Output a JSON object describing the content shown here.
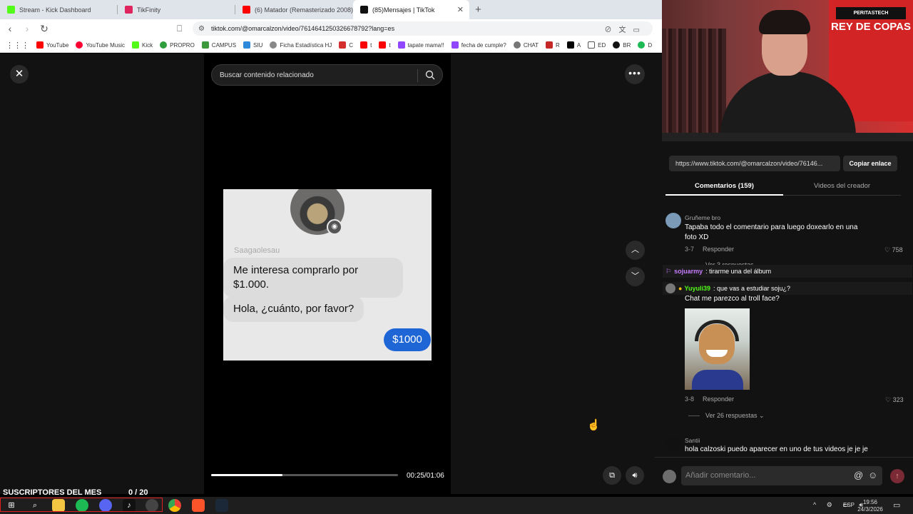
{
  "browser": {
    "tabs": [
      {
        "title": "Stream - Kick Dashboard",
        "color": "#53fc18"
      },
      {
        "title": "TikFinity",
        "color": "#e0245e"
      },
      {
        "title": "(6) Matador (Remasterizado 2008) -",
        "color": "#ff0000"
      },
      {
        "title": "(85)Mensajes | TikTok",
        "color": "#111111"
      }
    ],
    "url": "tiktok.com/@omarcalzon/video/7614641250326678792?lang=es",
    "bookmarks": [
      "YouTube",
      "YouTube Music",
      "Kick",
      "PROPRO",
      "CAMPUS",
      "SIU",
      "Ficha Estadística HJ",
      "C",
      "t",
      "t",
      "tapate mama!!",
      "fecha de cumple?",
      "CHAT",
      "R",
      "A",
      "ED",
      "BR",
      "D"
    ]
  },
  "tiktok": {
    "search_placeholder": "Buscar contenido relacionado",
    "video": {
      "username": "Saagaolesau",
      "message1": "Me interesa comprarlo por $1.000.",
      "message2": "Hola, ¿cuánto, por favor?",
      "reply": "$1000",
      "timecode": "00:25/01:06",
      "progress": 0.38
    }
  },
  "panel": {
    "link": "https://www.tiktok.com/@omarcalzon/video/76146...",
    "copy_label": "Copiar enlace",
    "tab_comments": "Comentarios (159)",
    "tab_creator": "Videos del creador",
    "comments": [
      {
        "user": "Gruñeme bro",
        "text": "Tapaba todo el comentario para luego doxearlo en una foto XD",
        "date": "3-7",
        "reply": "Responder",
        "likes": "758",
        "replies": "Ver 3 respuestas"
      },
      {
        "user": "Chat me parezco al troll face?",
        "text": "Chat me parezco al troll face?",
        "date": "3-8",
        "reply": "Responder",
        "likes": "323",
        "replies": "Ver 26 respuestas"
      },
      {
        "user": "Santii",
        "text": "hola calzoski puedo aparecer en uno de tus videos je je je"
      }
    ],
    "chat": [
      {
        "name": "sojuarmy",
        "text": ": tirarme una del álbum",
        "color": "#c77dff"
      },
      {
        "name": "Yuyuli39",
        "text": ": que vas a estudiar soju¿?",
        "color": "#53fc18"
      }
    ],
    "add_comment_placeholder": "Añadir comentario..."
  },
  "webcam": {
    "poster_text": "REY DE COPAS",
    "sticker": "PERITASTECH"
  },
  "overlay": {
    "subs_label": "SUSCRIPTORES DEL MES",
    "subs_count": "0 / 20"
  },
  "taskbar": {
    "lang": "ESP",
    "time": "19:56",
    "date": "24/3/2026"
  }
}
